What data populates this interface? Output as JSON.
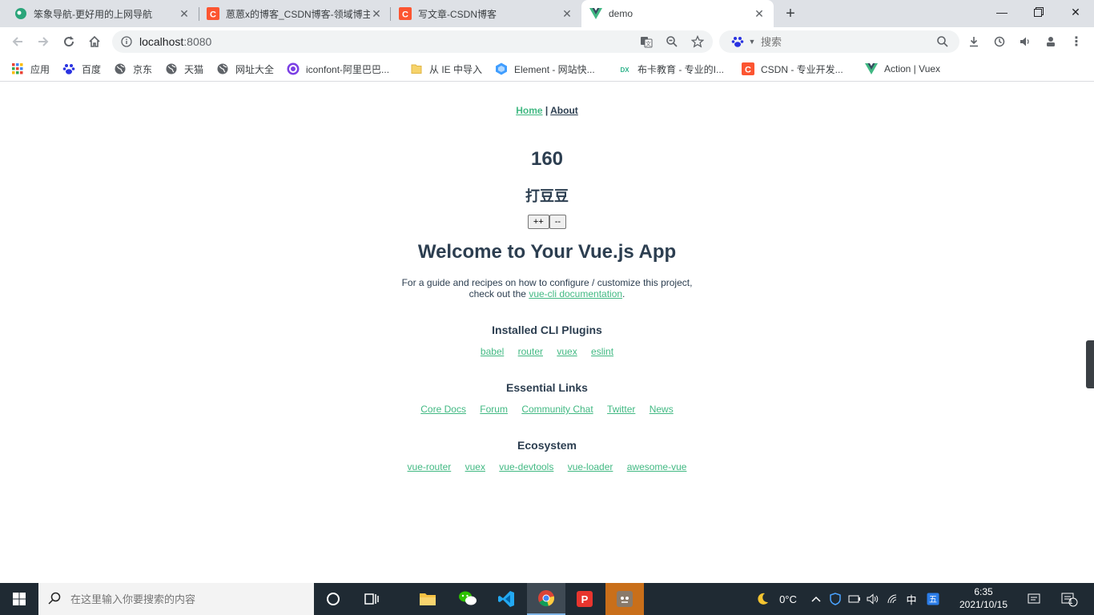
{
  "browser": {
    "tabs": [
      {
        "title": "笨象导航-更好用的上网导航",
        "favicon": "elephant-icon",
        "active": false
      },
      {
        "title": "蒽蒽x的博客_CSDN博客-领域博主",
        "favicon": "csdn-icon",
        "active": false
      },
      {
        "title": "写文章-CSDN博客",
        "favicon": "csdn-icon",
        "active": false
      },
      {
        "title": "demo",
        "favicon": "vue-icon",
        "active": true
      }
    ],
    "address": {
      "host": "localhost",
      "port": ":8080"
    },
    "search_placeholder": "搜索",
    "bookmarks": [
      {
        "label": "应用",
        "icon": "apps-grid-icon"
      },
      {
        "label": "百度",
        "icon": "baidu-icon"
      },
      {
        "label": "京东",
        "icon": "globe-icon"
      },
      {
        "label": "天猫",
        "icon": "globe-icon"
      },
      {
        "label": "网址大全",
        "icon": "globe-icon"
      },
      {
        "label": "iconfont-阿里巴巴...",
        "icon": "iconfont-icon"
      },
      {
        "label": "从 IE 中导入",
        "icon": "folder-icon"
      },
      {
        "label": "Element - 网站快...",
        "icon": "element-icon"
      },
      {
        "label": "布卡教育 - 专业的I...",
        "icon": "buka-icon"
      },
      {
        "label": "CSDN - 专业开发...",
        "icon": "csdn-icon"
      },
      {
        "label": "Action | Vuex",
        "icon": "vue-icon"
      }
    ]
  },
  "page": {
    "nav": {
      "home": "Home",
      "separator": " | ",
      "about": "About"
    },
    "count": "160",
    "subtitle": "打豆豆",
    "buttons": {
      "increment": "++",
      "decrement": "--"
    },
    "welcome": "Welcome to Your Vue.js App",
    "intro_line1": "For a guide and recipes on how to configure / customize this project,",
    "intro_line2_prefix": "check out the ",
    "intro_link": "vue-cli documentation",
    "intro_line2_suffix": ".",
    "sections": [
      {
        "title": "Installed CLI Plugins",
        "links": [
          "babel",
          "router",
          "vuex",
          "eslint"
        ]
      },
      {
        "title": "Essential Links",
        "links": [
          "Core Docs",
          "Forum",
          "Community Chat",
          "Twitter",
          "News"
        ]
      },
      {
        "title": "Ecosystem",
        "links": [
          "vue-router",
          "vuex",
          "vue-devtools",
          "vue-loader",
          "awesome-vue"
        ]
      }
    ]
  },
  "taskbar": {
    "search_placeholder": "在这里输入你要搜索的内容",
    "weather": "0°C",
    "ime": "中",
    "time": "6:35",
    "date": "2021/10/15",
    "notification_count": "1"
  },
  "colors": {
    "vue_green": "#42b983",
    "text": "#2c3e50",
    "tabstrip": "#dee1e6",
    "taskbar": "#1f2a33"
  }
}
